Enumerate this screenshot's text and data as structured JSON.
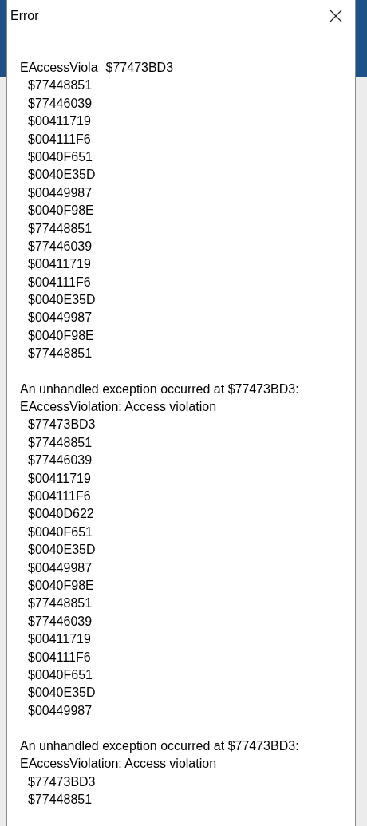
{
  "window": {
    "title": "Error"
  },
  "blocks": [
    {
      "lines": [
        {
          "parts": [
            "EAccessViola",
            "$77473BD3"
          ]
        }
      ],
      "addresses": [
        "$77448851",
        "$77446039",
        "$00411719",
        "$004111F6",
        "$0040F651",
        "$0040E35D",
        "$00449987",
        "$0040F98E",
        "$77448851",
        "$77446039",
        "$00411719",
        "$004111F6",
        "$0040E35D",
        "$00449987",
        "$0040F98E",
        "$77448851"
      ]
    },
    {
      "lines": [
        {
          "parts": [
            "An unhandled exception occurred at $77473BD3:"
          ]
        },
        {
          "parts": [
            "EAccessViolation: Access violation"
          ]
        }
      ],
      "addresses": [
        "$77473BD3",
        "$77448851",
        "$77446039",
        "$00411719",
        "$004111F6",
        "$0040D622",
        "$0040F651",
        "$0040E35D",
        "$00449987",
        "$0040F98E",
        "$77448851",
        "$77446039",
        "$00411719",
        "$004111F6",
        "$0040F651",
        "$0040E35D",
        "$00449987"
      ]
    },
    {
      "lines": [
        {
          "parts": [
            "An unhandled exception occurred at $77473BD3:"
          ]
        },
        {
          "parts": [
            "EAccessViolation: Access violation"
          ]
        }
      ],
      "addresses": [
        "$77473BD3",
        "$77448851"
      ]
    }
  ]
}
